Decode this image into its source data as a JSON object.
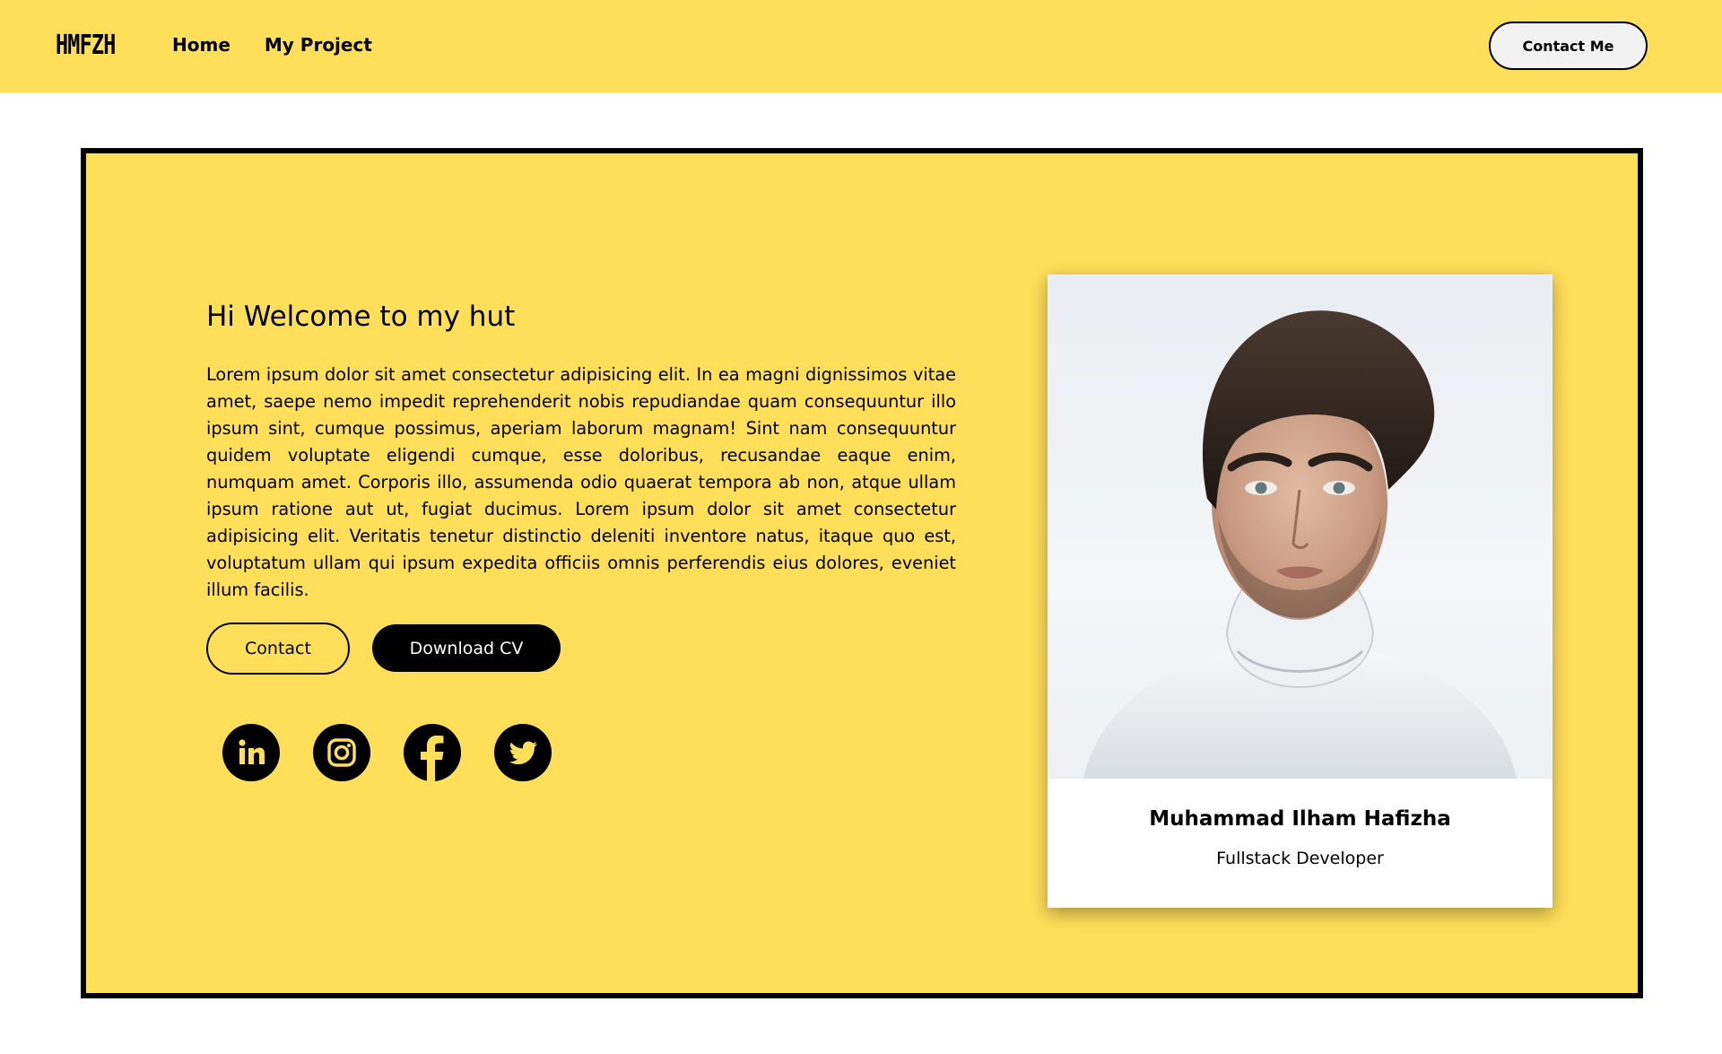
{
  "nav": {
    "logo": "HMFZH",
    "links": [
      "Home",
      "My Project"
    ],
    "contact_button": "Contact Me"
  },
  "hero": {
    "title": "Hi Welcome to my hut",
    "intro": "Lorem ipsum dolor sit amet consectetur adipisicing elit. In ea magni dignissimos vitae amet, saepe nemo impedit reprehenderit nobis repudiandae quam consequuntur illo ipsum sint, cumque possimus, aperiam laborum magnam! Sint nam consequuntur quidem voluptate eligendi cumque, esse doloribus, recusandae eaque enim, numquam amet. Corporis illo, assumenda odio quaerat tempora ab non, atque ullam ipsum ratione aut ut, fugiat ducimus. Lorem ipsum dolor sit amet consectetur adipisicing elit. Veritatis tenetur distinctio deleniti inventore natus, itaque quo est, voluptatum ullam qui ipsum expedita officiis omnis perferendis eius dolores, eveniet illum facilis.",
    "contact_button": "Contact",
    "download_button": "Download CV",
    "socials": [
      "linkedin-icon",
      "instagram-icon",
      "facebook-icon",
      "twitter-icon"
    ]
  },
  "profile": {
    "name": "Muhammad Ilham Hafizha",
    "role": "Fullstack Developer"
  },
  "colors": {
    "accent": "#ffde59",
    "dark": "#000000",
    "card": "#ffffff"
  }
}
